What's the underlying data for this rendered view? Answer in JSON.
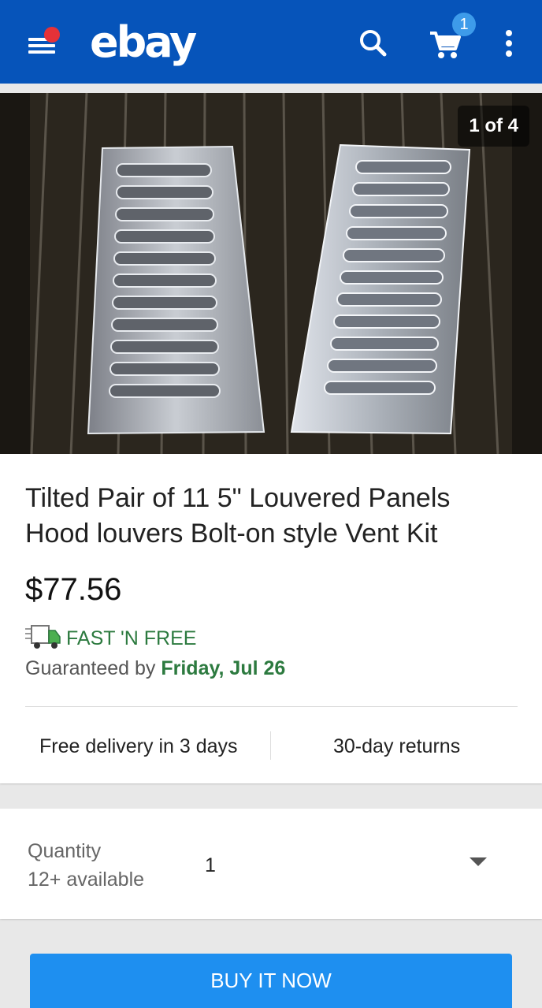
{
  "header": {
    "logo": "ebay",
    "cart_count": "1",
    "menu_icon": "menu-icon",
    "search_icon": "search-icon",
    "cart_icon": "cart-icon",
    "more_icon": "more-vertical-icon"
  },
  "gallery": {
    "counter": "1 of 4"
  },
  "item": {
    "title": "Tilted Pair of 11 5\" Louvered Panels Hood louvers Bolt-on style Vent Kit",
    "price": "$77.56",
    "shipping_badge": "FAST 'N FREE",
    "guaranteed_prefix": "Guaranteed by",
    "guaranteed_date": "Friday, Jul 26",
    "feature_delivery": "Free delivery in 3 days",
    "feature_returns": "30-day returns"
  },
  "quantity": {
    "label": "Quantity",
    "available": "12+ available",
    "value": "1"
  },
  "actions": {
    "buy_now": "BUY IT NOW"
  },
  "colors": {
    "brand_blue": "#0654ba",
    "button_blue": "#1e8ff0",
    "green": "#2c7a3f",
    "notification_red": "#e53238"
  }
}
